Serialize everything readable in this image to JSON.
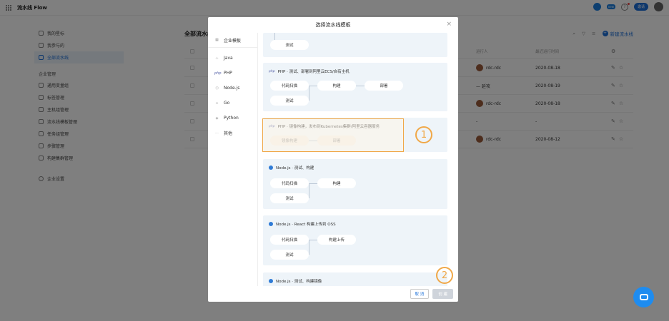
{
  "app": {
    "title": "流水线 Flow"
  },
  "topbar": {
    "badge": "new",
    "help": "?",
    "button_label": "邀请"
  },
  "sidebar": {
    "items": [
      {
        "label": "我的星标",
        "active": false
      },
      {
        "label": "我参与的",
        "active": false
      },
      {
        "label": "全部流水线",
        "active": true
      }
    ],
    "section_label": "企业管理",
    "manage_items": [
      {
        "label": "通用变量组"
      },
      {
        "label": "标签管理"
      },
      {
        "label": "主机组管理"
      },
      {
        "label": "流水线模板管理"
      },
      {
        "label": "任务组管理"
      },
      {
        "label": "步骤管理"
      },
      {
        "label": "构建集群管理"
      }
    ],
    "settings_label": "企业设置"
  },
  "main": {
    "title": "全部流水线",
    "new_button": "新建流水线",
    "columns": {
      "runner": "运行人",
      "last_run": "最近运行时间"
    },
    "rows": [
      {
        "runner": "rdc-rdc",
        "time": "2020-08-18"
      },
      {
        "runner": "— 延攻",
        "time": "2020-08-19"
      },
      {
        "runner": "rdc-rdc",
        "time": "2020-08-18"
      },
      {
        "runner": "-",
        "time": "-"
      },
      {
        "runner": "rdc-rdc",
        "time": "2020-08-12"
      }
    ]
  },
  "modal": {
    "title": "选择流水线模板",
    "categories": [
      {
        "label": "企业模板",
        "icon": "grid-icon"
      },
      {
        "label": "Java",
        "icon": "java-icon"
      },
      {
        "label": "PHP",
        "icon": "php-icon"
      },
      {
        "label": "Node.js",
        "icon": "nodejs-icon"
      },
      {
        "label": "Go",
        "icon": "go-icon"
      },
      {
        "label": "Python",
        "icon": "python-icon"
      },
      {
        "label": "其他",
        "icon": "more-icon"
      }
    ],
    "templates": {
      "t0": {
        "steps": [
          "测试"
        ]
      },
      "t1": {
        "title": "PHP · 测试、部署到阿里云ECS/自有主机",
        "steps": [
          "代码扫描",
          "构建",
          "部署",
          "测试"
        ]
      },
      "t2": {
        "title": "PHP · 镜像构建，发布到Kubernetes集群/阿里云容器服务",
        "steps": [
          "镜像构建",
          "部署"
        ]
      },
      "t3": {
        "title": "Node.js · 测试、构建",
        "steps": [
          "代码扫描",
          "构建",
          "测试"
        ]
      },
      "t4": {
        "title": "Node.js · React 构建上传到 OSS",
        "steps": [
          "代码扫描",
          "构建上传",
          "测试"
        ]
      },
      "t5": {
        "title": "Node.js · 测试、构建镜像"
      }
    },
    "cancel_label": "取 消",
    "create_label": "创 建"
  },
  "annotations": {
    "marker1": "1",
    "marker2": "2"
  },
  "colors": {
    "accent": "#1b6fd8",
    "highlight": "#f0a848"
  }
}
